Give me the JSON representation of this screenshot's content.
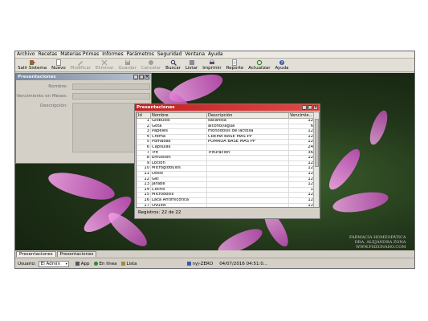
{
  "menu": [
    "Archivo",
    "Recetas",
    "Materias Primas",
    "Informes",
    "Parámetros",
    "Seguridad",
    "Ventana",
    "Ayuda"
  ],
  "toolbar": [
    {
      "label": "Salir Sistema",
      "icon": "exit-icon",
      "enabled": true
    },
    {
      "label": "Nuevo",
      "icon": "new-document-icon",
      "enabled": true
    },
    {
      "label": "Modificar",
      "icon": "edit-pencil-icon",
      "enabled": false
    },
    {
      "label": "Eliminar",
      "icon": "delete-icon",
      "enabled": false
    },
    {
      "label": "Guardar",
      "icon": "save-icon",
      "enabled": false
    },
    {
      "label": "Cancelar",
      "icon": "cancel-icon",
      "enabled": false
    },
    {
      "label": "Buscar",
      "icon": "search-icon",
      "enabled": true
    },
    {
      "label": "Listar",
      "icon": "list-icon",
      "enabled": true
    },
    {
      "label": "Imprimir",
      "icon": "print-icon",
      "enabled": true
    },
    {
      "label": "Reporte",
      "icon": "report-icon",
      "enabled": true
    },
    {
      "label": "Actualizar",
      "icon": "refresh-icon",
      "enabled": true
    },
    {
      "label": "Ayuda",
      "icon": "help-icon",
      "enabled": true
    }
  ],
  "form_window": {
    "title": "Presentaciones",
    "fields": [
      "Nombre:",
      "Vencimiento en Meses:",
      "Descripción:"
    ]
  },
  "list_window": {
    "title": "Presentaciones",
    "columns": [
      "Id",
      "Nombre",
      "Descripción",
      "Vencimie..."
    ],
    "rows": [
      [
        "1",
        "Glóbulos",
        "sacarosa",
        "12"
      ],
      [
        "2",
        "Gota",
        "alcohol/agua",
        "6"
      ],
      [
        "3",
        "Papeles",
        "monodosis de lactosa",
        "12"
      ],
      [
        "4",
        "Crema",
        "CREMA BASE MAS PP",
        "12"
      ],
      [
        "5",
        "Pomadas",
        "POMADA BASE MAS PP",
        "12"
      ],
      [
        "6",
        "Cápsulas",
        "",
        "24"
      ],
      [
        "7",
        "Trit",
        "Trituración",
        "36"
      ],
      [
        "8",
        "Emulsión",
        "",
        "12"
      ],
      [
        "9",
        "Loción",
        "",
        "12"
      ],
      [
        "10",
        "Microglóbulos",
        "",
        "12"
      ],
      [
        "11",
        "Dosis",
        "",
        "12"
      ],
      [
        "12",
        "Gel",
        "",
        "12"
      ],
      [
        "13",
        "Jarabe",
        "",
        "12"
      ],
      [
        "14",
        "Colirio",
        "",
        "1"
      ],
      [
        "15",
        "Microdosis",
        "",
        "12"
      ],
      [
        "16",
        "Laca Antimicotica",
        "",
        "12"
      ],
      [
        "17",
        "Óvulos",
        "",
        "12"
      ]
    ],
    "records_text": "Registros: 22 de 22"
  },
  "watermark": [
    "FARMACIA HOMEOPÁTICA",
    "DRA. ALEJANDRA ZONA",
    "WWW.FHZONAHO.COM"
  ],
  "tabs": [
    "Presentaciones",
    "Presentaciones"
  ],
  "status": {
    "user_label": "Usuario:",
    "user_value": "El Admin",
    "app_label": "App",
    "online_label": "En línea",
    "ready_label": "Lista",
    "db_text": "nyj-ZERO",
    "datetime": "04/07/2016 04:51:0..."
  },
  "colors": {
    "active_title": "#c02020",
    "inactive_title": "#7a8a9e",
    "app_bg": "#d4d0c8"
  }
}
